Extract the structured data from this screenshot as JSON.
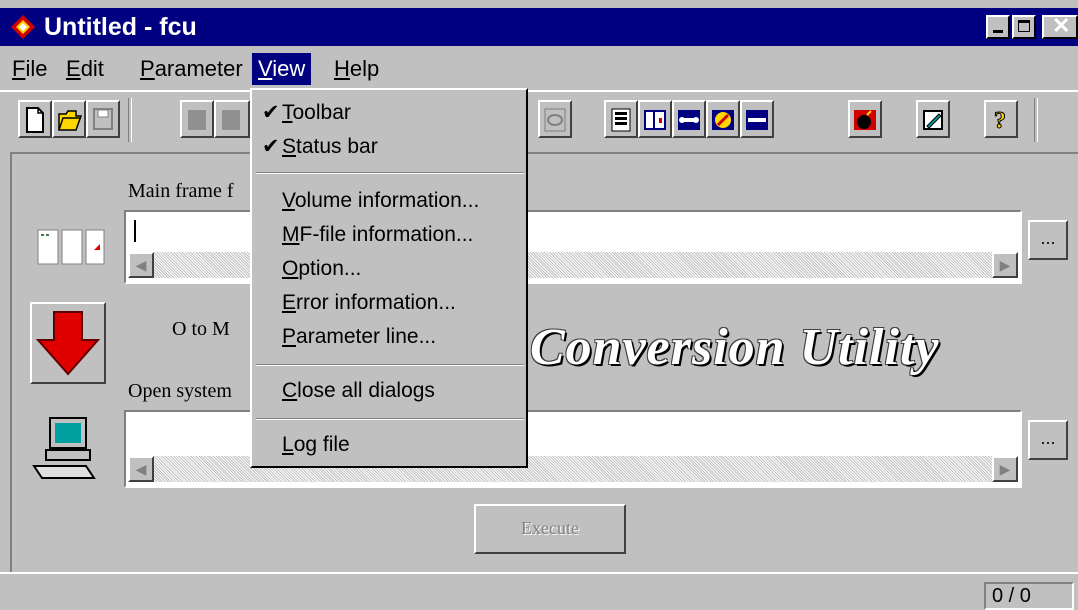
{
  "window": {
    "title": "Untitled - fcu"
  },
  "menubar": {
    "items": [
      {
        "label": "File",
        "mnemonic": "F",
        "rest": "ile"
      },
      {
        "label": "Edit",
        "mnemonic": "E",
        "rest": "dit"
      },
      {
        "label": "Parameter",
        "mnemonic": "P",
        "rest": "arameter"
      },
      {
        "label": "View",
        "mnemonic": "V",
        "rest": "iew",
        "open": true
      },
      {
        "label": "Help",
        "mnemonic": "H",
        "rest": "elp"
      }
    ]
  },
  "view_menu": {
    "items": [
      {
        "label": "Toolbar",
        "mnemonic": "T",
        "rest": "oolbar",
        "checked": true
      },
      {
        "label": "Status bar",
        "mnemonic": "S",
        "rest": "tatus bar",
        "checked": true
      },
      {
        "label": "Volume information...",
        "mnemonic": "V",
        "rest": "olume information..."
      },
      {
        "label": "MF-file information...",
        "mnemonic": "M",
        "rest": "F-file information..."
      },
      {
        "label": "Option...",
        "mnemonic": "O",
        "rest": "ption..."
      },
      {
        "label": "Error information...",
        "mnemonic": "E",
        "rest": "rror information..."
      },
      {
        "label": "Parameter line...",
        "mnemonic": "P",
        "rest": "arameter line..."
      },
      {
        "label": "Close all dialogs",
        "mnemonic": "C",
        "rest": "lose all dialogs"
      },
      {
        "label": "Log file",
        "mnemonic": "L",
        "rest": "og file"
      }
    ]
  },
  "main": {
    "mainframe_label": "Main frame f",
    "direction_label": "O to M",
    "opensystem_label": "Open system",
    "browse_label": "...",
    "app_title": "Conversion Utility",
    "execute_label": "Execute"
  },
  "statusbar": {
    "count": "0 / 0"
  },
  "colors": {
    "titlebar": "#000080",
    "face": "#c0c0c0",
    "arrow": "#e00000"
  }
}
